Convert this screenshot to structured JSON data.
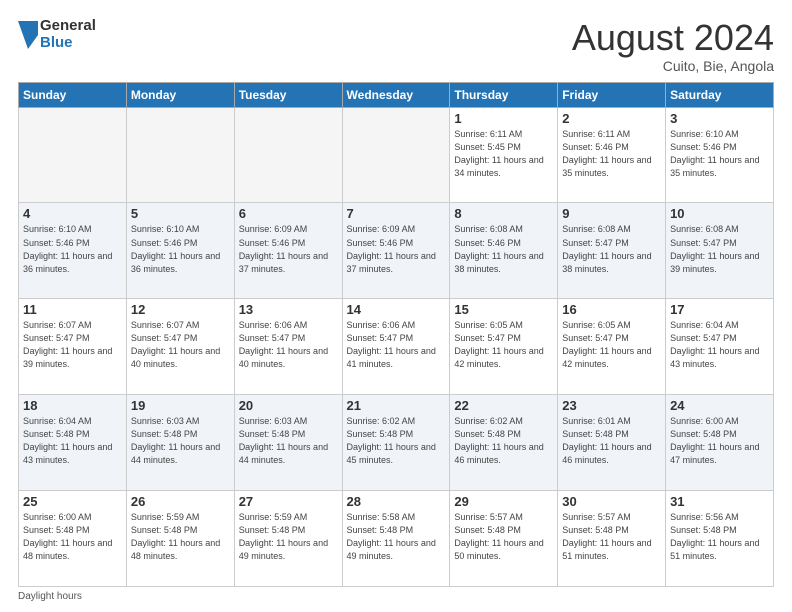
{
  "logo": {
    "general": "General",
    "blue": "Blue"
  },
  "title": "August 2024",
  "subtitle": "Cuito, Bie, Angola",
  "days_of_week": [
    "Sunday",
    "Monday",
    "Tuesday",
    "Wednesday",
    "Thursday",
    "Friday",
    "Saturday"
  ],
  "footer": "Daylight hours",
  "weeks": [
    [
      {
        "day": "",
        "empty": true
      },
      {
        "day": "",
        "empty": true
      },
      {
        "day": "",
        "empty": true
      },
      {
        "day": "",
        "empty": true
      },
      {
        "day": "1",
        "sunrise": "Sunrise: 6:11 AM",
        "sunset": "Sunset: 5:45 PM",
        "daylight": "Daylight: 11 hours and 34 minutes."
      },
      {
        "day": "2",
        "sunrise": "Sunrise: 6:11 AM",
        "sunset": "Sunset: 5:46 PM",
        "daylight": "Daylight: 11 hours and 35 minutes."
      },
      {
        "day": "3",
        "sunrise": "Sunrise: 6:10 AM",
        "sunset": "Sunset: 5:46 PM",
        "daylight": "Daylight: 11 hours and 35 minutes."
      }
    ],
    [
      {
        "day": "4",
        "sunrise": "Sunrise: 6:10 AM",
        "sunset": "Sunset: 5:46 PM",
        "daylight": "Daylight: 11 hours and 36 minutes."
      },
      {
        "day": "5",
        "sunrise": "Sunrise: 6:10 AM",
        "sunset": "Sunset: 5:46 PM",
        "daylight": "Daylight: 11 hours and 36 minutes."
      },
      {
        "day": "6",
        "sunrise": "Sunrise: 6:09 AM",
        "sunset": "Sunset: 5:46 PM",
        "daylight": "Daylight: 11 hours and 37 minutes."
      },
      {
        "day": "7",
        "sunrise": "Sunrise: 6:09 AM",
        "sunset": "Sunset: 5:46 PM",
        "daylight": "Daylight: 11 hours and 37 minutes."
      },
      {
        "day": "8",
        "sunrise": "Sunrise: 6:08 AM",
        "sunset": "Sunset: 5:46 PM",
        "daylight": "Daylight: 11 hours and 38 minutes."
      },
      {
        "day": "9",
        "sunrise": "Sunrise: 6:08 AM",
        "sunset": "Sunset: 5:47 PM",
        "daylight": "Daylight: 11 hours and 38 minutes."
      },
      {
        "day": "10",
        "sunrise": "Sunrise: 6:08 AM",
        "sunset": "Sunset: 5:47 PM",
        "daylight": "Daylight: 11 hours and 39 minutes."
      }
    ],
    [
      {
        "day": "11",
        "sunrise": "Sunrise: 6:07 AM",
        "sunset": "Sunset: 5:47 PM",
        "daylight": "Daylight: 11 hours and 39 minutes."
      },
      {
        "day": "12",
        "sunrise": "Sunrise: 6:07 AM",
        "sunset": "Sunset: 5:47 PM",
        "daylight": "Daylight: 11 hours and 40 minutes."
      },
      {
        "day": "13",
        "sunrise": "Sunrise: 6:06 AM",
        "sunset": "Sunset: 5:47 PM",
        "daylight": "Daylight: 11 hours and 40 minutes."
      },
      {
        "day": "14",
        "sunrise": "Sunrise: 6:06 AM",
        "sunset": "Sunset: 5:47 PM",
        "daylight": "Daylight: 11 hours and 41 minutes."
      },
      {
        "day": "15",
        "sunrise": "Sunrise: 6:05 AM",
        "sunset": "Sunset: 5:47 PM",
        "daylight": "Daylight: 11 hours and 42 minutes."
      },
      {
        "day": "16",
        "sunrise": "Sunrise: 6:05 AM",
        "sunset": "Sunset: 5:47 PM",
        "daylight": "Daylight: 11 hours and 42 minutes."
      },
      {
        "day": "17",
        "sunrise": "Sunrise: 6:04 AM",
        "sunset": "Sunset: 5:47 PM",
        "daylight": "Daylight: 11 hours and 43 minutes."
      }
    ],
    [
      {
        "day": "18",
        "sunrise": "Sunrise: 6:04 AM",
        "sunset": "Sunset: 5:48 PM",
        "daylight": "Daylight: 11 hours and 43 minutes."
      },
      {
        "day": "19",
        "sunrise": "Sunrise: 6:03 AM",
        "sunset": "Sunset: 5:48 PM",
        "daylight": "Daylight: 11 hours and 44 minutes."
      },
      {
        "day": "20",
        "sunrise": "Sunrise: 6:03 AM",
        "sunset": "Sunset: 5:48 PM",
        "daylight": "Daylight: 11 hours and 44 minutes."
      },
      {
        "day": "21",
        "sunrise": "Sunrise: 6:02 AM",
        "sunset": "Sunset: 5:48 PM",
        "daylight": "Daylight: 11 hours and 45 minutes."
      },
      {
        "day": "22",
        "sunrise": "Sunrise: 6:02 AM",
        "sunset": "Sunset: 5:48 PM",
        "daylight": "Daylight: 11 hours and 46 minutes."
      },
      {
        "day": "23",
        "sunrise": "Sunrise: 6:01 AM",
        "sunset": "Sunset: 5:48 PM",
        "daylight": "Daylight: 11 hours and 46 minutes."
      },
      {
        "day": "24",
        "sunrise": "Sunrise: 6:00 AM",
        "sunset": "Sunset: 5:48 PM",
        "daylight": "Daylight: 11 hours and 47 minutes."
      }
    ],
    [
      {
        "day": "25",
        "sunrise": "Sunrise: 6:00 AM",
        "sunset": "Sunset: 5:48 PM",
        "daylight": "Daylight: 11 hours and 48 minutes."
      },
      {
        "day": "26",
        "sunrise": "Sunrise: 5:59 AM",
        "sunset": "Sunset: 5:48 PM",
        "daylight": "Daylight: 11 hours and 48 minutes."
      },
      {
        "day": "27",
        "sunrise": "Sunrise: 5:59 AM",
        "sunset": "Sunset: 5:48 PM",
        "daylight": "Daylight: 11 hours and 49 minutes."
      },
      {
        "day": "28",
        "sunrise": "Sunrise: 5:58 AM",
        "sunset": "Sunset: 5:48 PM",
        "daylight": "Daylight: 11 hours and 49 minutes."
      },
      {
        "day": "29",
        "sunrise": "Sunrise: 5:57 AM",
        "sunset": "Sunset: 5:48 PM",
        "daylight": "Daylight: 11 hours and 50 minutes."
      },
      {
        "day": "30",
        "sunrise": "Sunrise: 5:57 AM",
        "sunset": "Sunset: 5:48 PM",
        "daylight": "Daylight: 11 hours and 51 minutes."
      },
      {
        "day": "31",
        "sunrise": "Sunrise: 5:56 AM",
        "sunset": "Sunset: 5:48 PM",
        "daylight": "Daylight: 11 hours and 51 minutes."
      }
    ]
  ]
}
